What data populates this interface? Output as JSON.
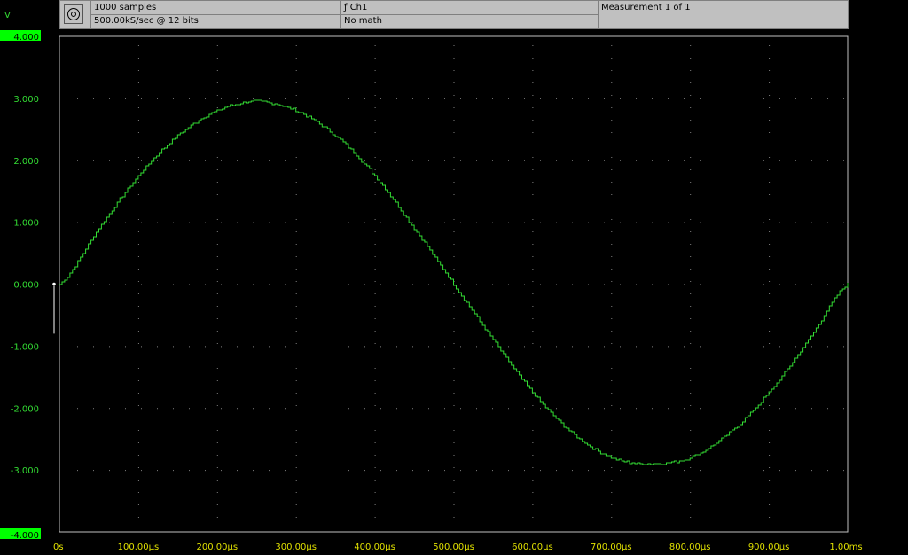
{
  "header": {
    "samples": "1000 samples",
    "rate": "500.00kS/sec @ 12 bits",
    "channel": "ƒ Ch1",
    "math": "No math",
    "measurement": "Measurement 1 of 1"
  },
  "colors": {
    "trace": "#33dd33",
    "tick_label": "#33dd33",
    "x_tick_label": "#e0e000",
    "range_label_bg": "#00ff00",
    "grid": "#808080",
    "frame": "#c0c0c0",
    "background": "#000000"
  },
  "chart_data": {
    "type": "line",
    "title": "",
    "xlabel": "",
    "ylabel": "V",
    "xlim": [
      0,
      1.0
    ],
    "ylim": [
      -4.0,
      4.0
    ],
    "x_unit": "ms",
    "y_ticks": [
      "4.000",
      "3.000",
      "2.000",
      "1.000",
      "0.000",
      "-1.000",
      "-2.000",
      "-3.000",
      "-4.000"
    ],
    "y_tick_values": [
      4,
      3,
      2,
      1,
      0,
      -1,
      -2,
      -3,
      -4
    ],
    "x_ticks": [
      "0s",
      "100.00µs",
      "200.00µs",
      "300.00µs",
      "400.00µs",
      "500.00µs",
      "600.00µs",
      "700.00µs",
      "800.00µs",
      "900.00µs",
      "1.00ms"
    ],
    "x_tick_values": [
      0,
      0.1,
      0.2,
      0.3,
      0.4,
      0.5,
      0.6,
      0.7,
      0.8,
      0.9,
      1.0
    ],
    "grid": true,
    "series": [
      {
        "x": [
          0,
          0.05,
          0.1,
          0.15,
          0.2,
          0.25,
          0.3,
          0.35,
          0.4,
          0.45,
          0.5,
          0.55,
          0.6,
          0.65,
          0.7,
          0.75,
          0.8,
          0.85,
          0.9,
          0.95,
          1.0
        ],
        "y": [
          0.0,
          0.9,
          1.75,
          2.4,
          2.8,
          2.95,
          2.8,
          2.4,
          1.75,
          0.9,
          0.0,
          -0.9,
          -1.75,
          -2.4,
          -2.8,
          -2.9,
          -2.8,
          -2.4,
          -1.75,
          -0.9,
          0.0
        ]
      }
    ]
  }
}
